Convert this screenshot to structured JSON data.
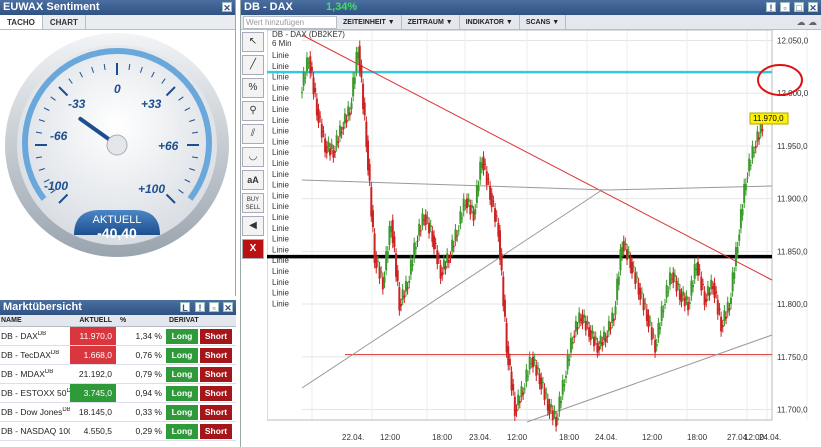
{
  "sentiment": {
    "title": "EUWAX Sentiment",
    "tabs": [
      "TACHO",
      "CHART"
    ],
    "ticks": [
      "-100",
      "-66",
      "-33",
      "0",
      "+33",
      "+66",
      "+100"
    ],
    "label": "AKTUELL",
    "value": "-40,40",
    "value_num": -40.4
  },
  "market": {
    "title": "Marktübersicht",
    "headers": [
      "NAME",
      "AKTUELL",
      "%",
      "DERIVAT"
    ],
    "rows": [
      {
        "name": "DB - DAX",
        "sup": "DB",
        "value": "11.970,0",
        "pct": "1,34 %",
        "style": "red",
        "long": "Long",
        "short": "Short"
      },
      {
        "name": "DB - TecDAX",
        "sup": "DB",
        "value": "1.668,0",
        "pct": "0,76 %",
        "style": "red",
        "long": "Long",
        "short": "Short"
      },
      {
        "name": "DB - MDAX",
        "sup": "DB",
        "value": "21.192,0",
        "pct": "0,79 %",
        "style": "",
        "long": "Long",
        "short": "Short"
      },
      {
        "name": "DB - ESTOXX 50",
        "sup": "DB",
        "value": "3.745,0",
        "pct": "0,94 %",
        "style": "green",
        "long": "Long",
        "short": "Short"
      },
      {
        "name": "DB - Dow Jones",
        "sup": "DB",
        "value": "18.145,0",
        "pct": "0,33 %",
        "style": "",
        "long": "Long",
        "short": "Short"
      },
      {
        "name": "DB - NASDAQ 100",
        "sup": "DB",
        "value": "4.550,5",
        "pct": "0,29 %",
        "style": "",
        "long": "Long",
        "short": "Short"
      }
    ]
  },
  "chart_panel": {
    "title": "DB - DAX",
    "change": "1,34%",
    "search_placeholder": "Wert hinzufügen",
    "menus": [
      "ZEITEINHEIT",
      "ZEITRAUM",
      "INDIKATOR",
      "SCANS"
    ],
    "instrument": "DB - DAX (DB2KE7)",
    "interval": "6 Min",
    "tools": [
      "pointer",
      "line",
      "percent",
      "zoom",
      "parallel",
      "curve",
      "aA",
      "BUY SELL",
      "sound",
      "X"
    ],
    "linie_label": "Linie",
    "linie_count": 24,
    "last_price_label": "11.970,0"
  },
  "chart_data": {
    "type": "line",
    "title": "DB - DAX (DB2KE7)",
    "ylim": [
      11690,
      12060
    ],
    "yticks": [
      11700,
      11750,
      11800,
      11850,
      11900,
      11950,
      12000,
      12050
    ],
    "ytick_labels": [
      "11.700,0",
      "11.750,0",
      "11.800,0",
      "11.850,0",
      "11.900,0",
      "11.950,0",
      "12.000,0",
      "12.050,0"
    ],
    "xtick_labels": [
      "22.04.",
      "12:00",
      "18:00",
      "23.04.",
      "12:00",
      "18:00",
      "24.04.",
      "12:00",
      "18:00",
      "27.04.",
      "12:00",
      "24.04."
    ],
    "series": [
      {
        "values": [
          12000,
          12035,
          11985,
          11950,
          11945,
          11968,
          11985,
          12045,
          11955,
          11845,
          11820,
          11880,
          11800,
          11820,
          11860,
          11885,
          11865,
          11830,
          11845,
          11870,
          11900,
          11885,
          11940,
          11905,
          11870,
          11760,
          11700,
          11720,
          11750,
          11730,
          11705,
          11690,
          11730,
          11770,
          11790,
          11775,
          11760,
          11770,
          11790,
          11860,
          11840,
          11815,
          11790,
          11760,
          11800,
          11830,
          11810,
          11800,
          11840,
          11805,
          11820,
          11780,
          11800,
          11860,
          11920,
          11950,
          11970
        ]
      }
    ],
    "hlines": [
      {
        "y": 12020,
        "color": "#33c9e0"
      },
      {
        "y": 11845,
        "color": "#000000"
      },
      {
        "y": 11752,
        "color": "#d33333"
      }
    ],
    "last_value": 11970
  },
  "colors": {
    "title_bar": "#2f5283",
    "long": "#2e9a3a",
    "short": "#a4161a",
    "accent_red": "#d9363e"
  }
}
